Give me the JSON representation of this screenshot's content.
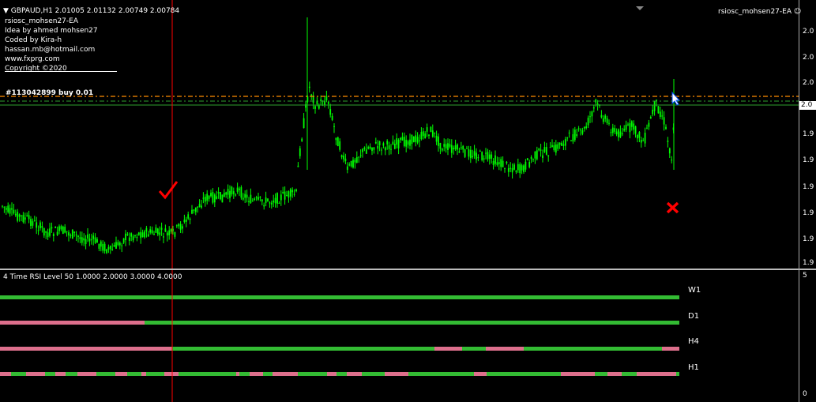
{
  "chart": {
    "symbol_line": "GBPAUD,H1  2.01005 2.01132 2.00749 2.00784",
    "ea_name": "rsiosc_mohsen27-EA",
    "ea_status_label": "rsiosc_mohsen27-EA",
    "info_lines": [
      "rsiosc_mohsen27-EA",
      "Idea by ahmed mohsen27",
      "Coded by Kira-h",
      "hassan.mb@hotmail.com",
      "www.fxprg.com",
      "Copyright ©2020"
    ],
    "order_label": "#113042899 buy 0.01",
    "price_ticks": [
      "2.0",
      "2.0",
      "2.0",
      "2.0",
      "1.9",
      "1.9",
      "1.9",
      "1.9",
      "1.9",
      "1.9"
    ],
    "current_price_tag": "2.0",
    "colors": {
      "background": "#000000",
      "candle": "#00ff00",
      "order_line": "#ff8c00",
      "vline": "#ff0000",
      "check": "#ff0000"
    }
  },
  "indicator": {
    "title": "4 Time RSI Level 50 1.0000 2.0000 3.0000 4.0000",
    "scale_top": "5",
    "scale_bottom": "0",
    "rows": [
      {
        "label": "W1"
      },
      {
        "label": "D1"
      },
      {
        "label": "H4"
      },
      {
        "label": "H1"
      }
    ],
    "colors": {
      "up": "#33bb33",
      "down": "#dd6f8c"
    }
  }
}
